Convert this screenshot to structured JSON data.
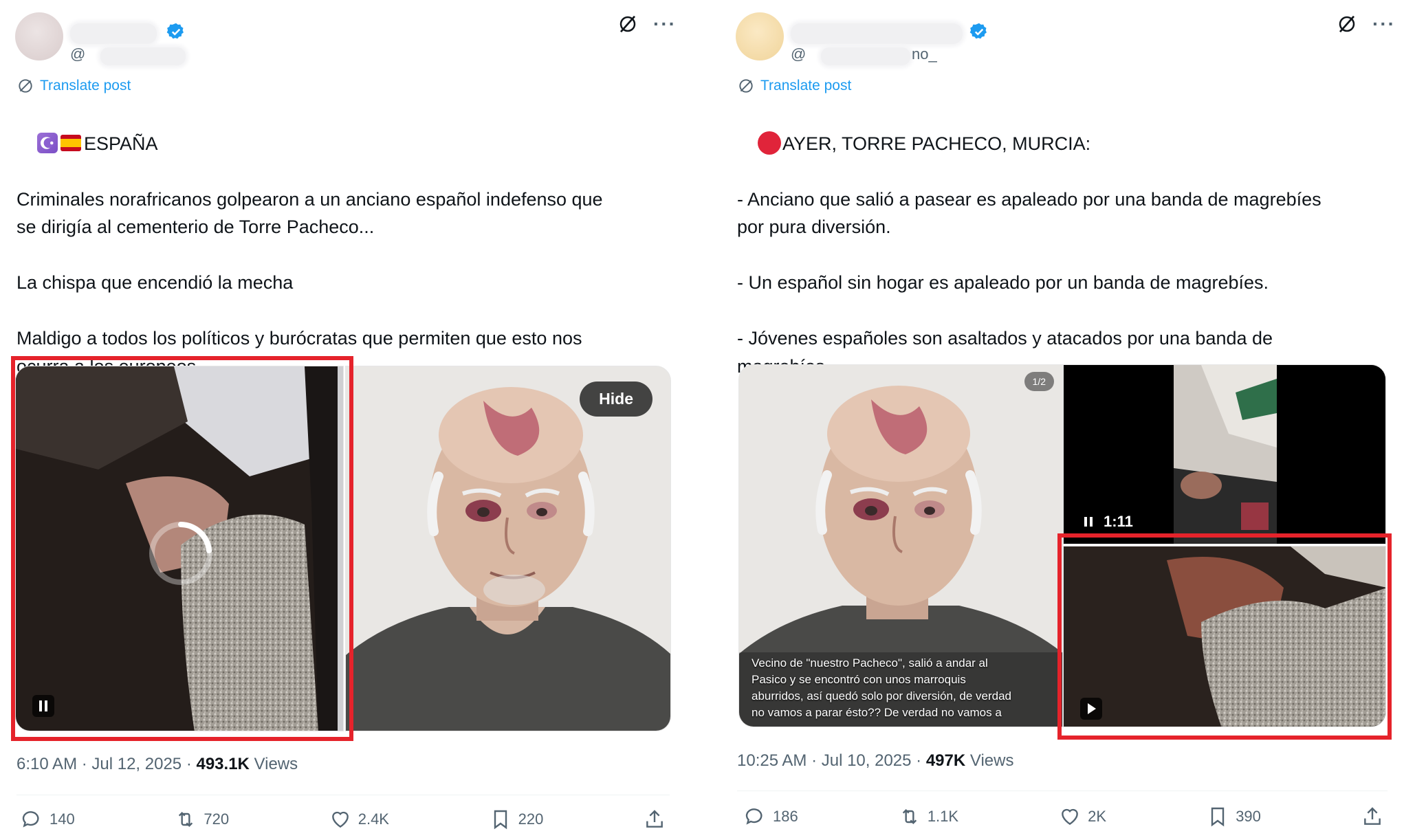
{
  "left_post": {
    "translate_label": "Translate post",
    "handle_at": "@",
    "text": "ESPAÑA\n\nCriminales norafricanos golpearon a un anciano español indefenso que\nse dirigía al cementerio de Torre Pacheco...\n\nLa chispa que encendió la mecha\n\nMaldigo a todos los políticos y burócratas que permiten que esto nos\nocurra a los europeos",
    "hide_label": "Hide",
    "time": "6:10 AM · Jul 12, 2025 · ",
    "views_count": "493.1K",
    "views_label": " Views",
    "stats": {
      "replies": "140",
      "reposts": "720",
      "likes": "2.4K",
      "bookmarks": "220"
    }
  },
  "right_post": {
    "translate_label": "Translate post",
    "handle_at": "@",
    "handle_tail": "no_",
    "text": "AYER, TORRE PACHECO, MURCIA:\n\n- Anciano que salió a pasear es apaleado por una banda de magrebíes\npor pura diversión.\n\n- Un español sin hogar es apaleado por un banda de magrebíes.\n\n- Jóvenes españoles son asaltados y atacados por una banda de\nmagrebíes.",
    "media_badge": "1/2",
    "caption": "Vecino de \"nuestro Pacheco\", salió a andar al\nPasico y se encontró con unos marroquis\naburridos, así quedó solo por diversión, de verdad\nno vamos a parar ésto?? De verdad no vamos a",
    "video_time": "1:11",
    "time": "10:25 AM · Jul 10, 2025 · ",
    "views_count": "497K",
    "views_label": " Views",
    "stats": {
      "replies": "186",
      "reposts": "1.1K",
      "likes": "2K",
      "bookmarks": "390"
    }
  },
  "colors": {
    "accent": "#1d9bf0",
    "highlight_frame": "#e5232b",
    "muted_text": "#536471"
  }
}
